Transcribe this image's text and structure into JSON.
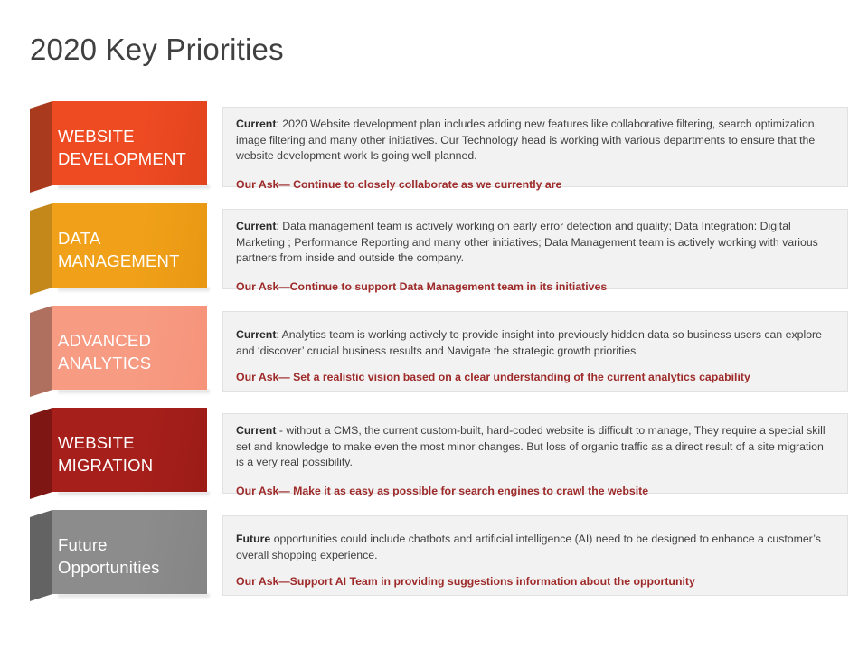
{
  "slide": {
    "title": "2020 Key Priorities"
  },
  "rows": [
    {
      "label": "WEBSITE\nDEVELOPMENT",
      "label_case": "upper",
      "front_color": "#EE4B23",
      "front_color_dark": "#E2431D",
      "side_color": "#A93A1E",
      "current_lead": "Current",
      "current_sep": ": ",
      "current_text": "2020 Website development  plan includes adding new features like collaborative  filtering,  search optimization,  image filtering and many other initiatives.  Our Technology  head is working  with various  departments to ensure that the website  development  work Is going well planned.",
      "ask_text": "Our Ask—  Continue to closely  collaborate as we currently are"
    },
    {
      "label": "DATA\nMANAGEMENT",
      "label_case": "upper",
      "front_color": "#F0A119",
      "front_color_dark": "#E89712",
      "side_color": "#C4881A",
      "current_lead": "Current",
      "current_sep": ": ",
      "current_text": "Data management team is actively working  on early error  detection and quality; Data Integration:  Digital Marketing ; Performance  Reporting and many other initiatives; Data Management  team is actively working with various  partners  from inside and outside the company.",
      "ask_text": "Our Ask—Continue  to support  Data Management team in its initiatives"
    },
    {
      "label": "ADVANCED\nANALYTICS",
      "label_case": "upper",
      "front_color": "#F79B83",
      "front_color_dark": "#F6937A",
      "side_color": "#B0705F",
      "current_lead": "Current",
      "current_sep": ": ",
      "current_text": "Analytics team is working actively to provide  insight into previously  hidden  data so business users can explore and ‘discover’  crucial business results and Navigate  the strategic growth  priorities",
      "ask_text": "Our Ask—  Set a realistic vision based on a clear understanding of the current analytics capability"
    },
    {
      "label": "WEBSITE\nMIGRATION",
      "label_case": "upper",
      "front_color": "#A61F1B",
      "front_color_dark": "#9C1C18",
      "side_color": "#7E1714",
      "current_lead": "Current",
      "current_sep": " - ",
      "current_text": "without a CMS, the current custom-built, hard-coded website is difficult to manage, They require  a special skill set and knowledge  to make even  the most minor changes. But loss of organic  traffic as a direct result of a site migration  is a very  real possibility.",
      "ask_text": "Our Ask—  Make it as easy as possible  for search engines to crawl the website"
    },
    {
      "label": "Future\nOpportunities",
      "label_case": "mixed",
      "front_color": "#8C8C8C",
      "front_color_dark": "#858585",
      "side_color": "#636363",
      "current_lead": "Future",
      "current_sep": " ",
      "current_text": "opportunities  could include chatbots and artificial intelligence (AI) need to be designed to enhance a customer’s overall  shopping experience.",
      "ask_text": "Our Ask—Support  AI Team in providing suggestions  information about the opportunity"
    }
  ],
  "colors": {
    "title": "#404040",
    "panel_bg": "#F2F2F2",
    "panel_border": "#E2E2E2",
    "body_text": "#3F3F3F",
    "ask_text": "#9E2A2A"
  }
}
